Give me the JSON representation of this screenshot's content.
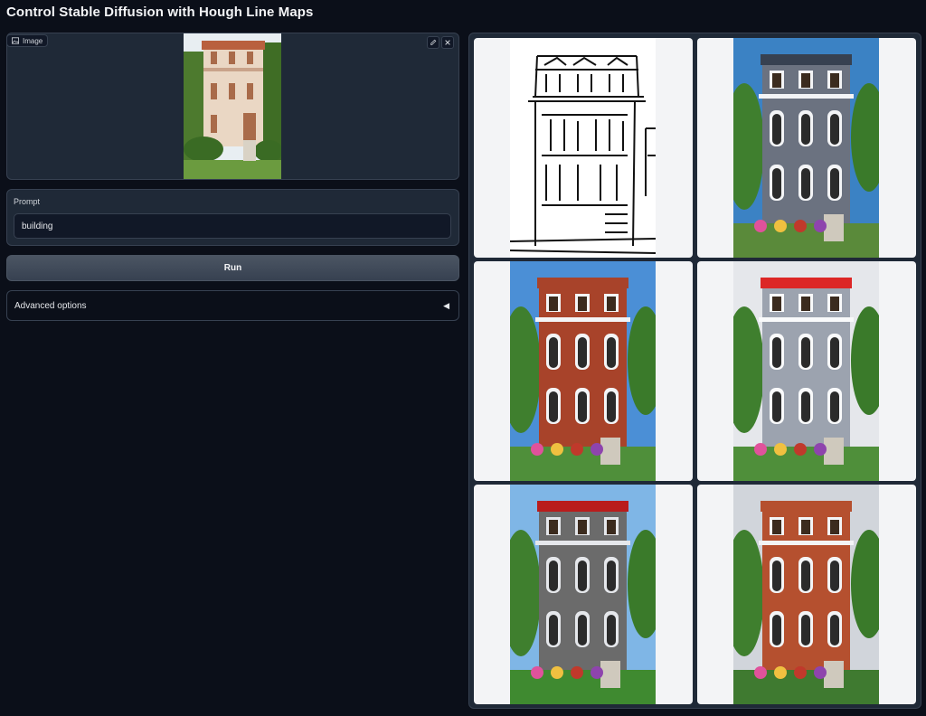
{
  "app": {
    "title": "Control Stable Diffusion with Hough Line Maps"
  },
  "image_input": {
    "label": "Image",
    "edit_icon": "pencil-icon",
    "clear_icon": "close-icon"
  },
  "prompt": {
    "label": "Prompt",
    "value": "building",
    "placeholder": ""
  },
  "run_button": {
    "label": "Run"
  },
  "advanced": {
    "label": "Advanced options",
    "icon": "triangle-left-icon"
  },
  "gallery": {
    "items": [
      {
        "kind": "line-map"
      },
      {
        "kind": "building",
        "colors": {
          "sky": "#3b82c4",
          "wall": "#6b7280",
          "roof": "#374151",
          "trim": "#f3f4f6",
          "ground": "#5a8a3a"
        }
      },
      {
        "kind": "building",
        "colors": {
          "sky": "#4b8fd6",
          "wall": "#a8432a",
          "roof": "#a8432a",
          "trim": "#f3f4f6",
          "ground": "#4f8f3a"
        }
      },
      {
        "kind": "building",
        "colors": {
          "sky": "#e5e7eb",
          "wall": "#9ca3af",
          "roof": "#dc2626",
          "trim": "#f9fafb",
          "ground": "#4f8f3a"
        }
      },
      {
        "kind": "building",
        "colors": {
          "sky": "#7fb6e6",
          "wall": "#6b6b6b",
          "roof": "#b91c1c",
          "trim": "#e5e7eb",
          "ground": "#3f8a30"
        }
      },
      {
        "kind": "building",
        "colors": {
          "sky": "#d1d5db",
          "wall": "#b5502f",
          "roof": "#b5502f",
          "trim": "#f3f4f6",
          "ground": "#3f7a30"
        }
      }
    ]
  }
}
